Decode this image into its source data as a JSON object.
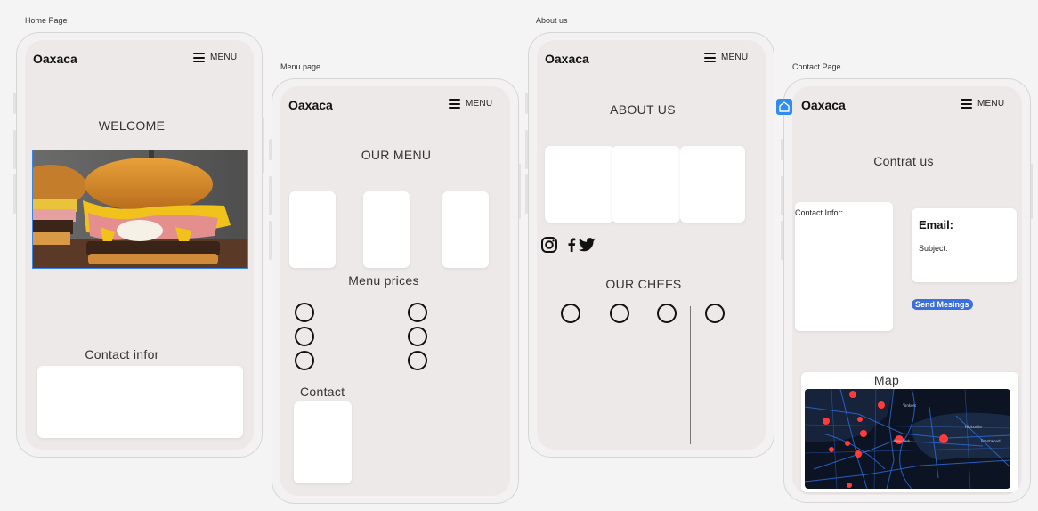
{
  "frames": {
    "home": "Home Page",
    "menu": "Menu page",
    "about": "About us",
    "contact": "Contact Page"
  },
  "nav": {
    "brand": "Oaxaca",
    "menu_label": "MENU"
  },
  "home": {
    "welcome": "WELCOME",
    "contact_heading": "Contact infor"
  },
  "menu_page": {
    "heading": "OUR MENU",
    "prices_heading": "Menu prices",
    "contact_heading": "Contact"
  },
  "about": {
    "heading": "ABOUT US",
    "chefs_heading": "OUR CHEFS",
    "social": [
      "instagram-icon",
      "facebook-icon",
      "twitter-icon"
    ]
  },
  "contact_page": {
    "heading": "Contrat us",
    "contact_info_label": "Contact Infor:",
    "email_label": "Email:",
    "subject_label": "Subject:",
    "send_button": "Send Mesings",
    "map_heading": "Map"
  },
  "colors": {
    "selection": "#3a86e8",
    "send_button": "#3b6fe0",
    "home_badge": "#2f8cf0"
  }
}
